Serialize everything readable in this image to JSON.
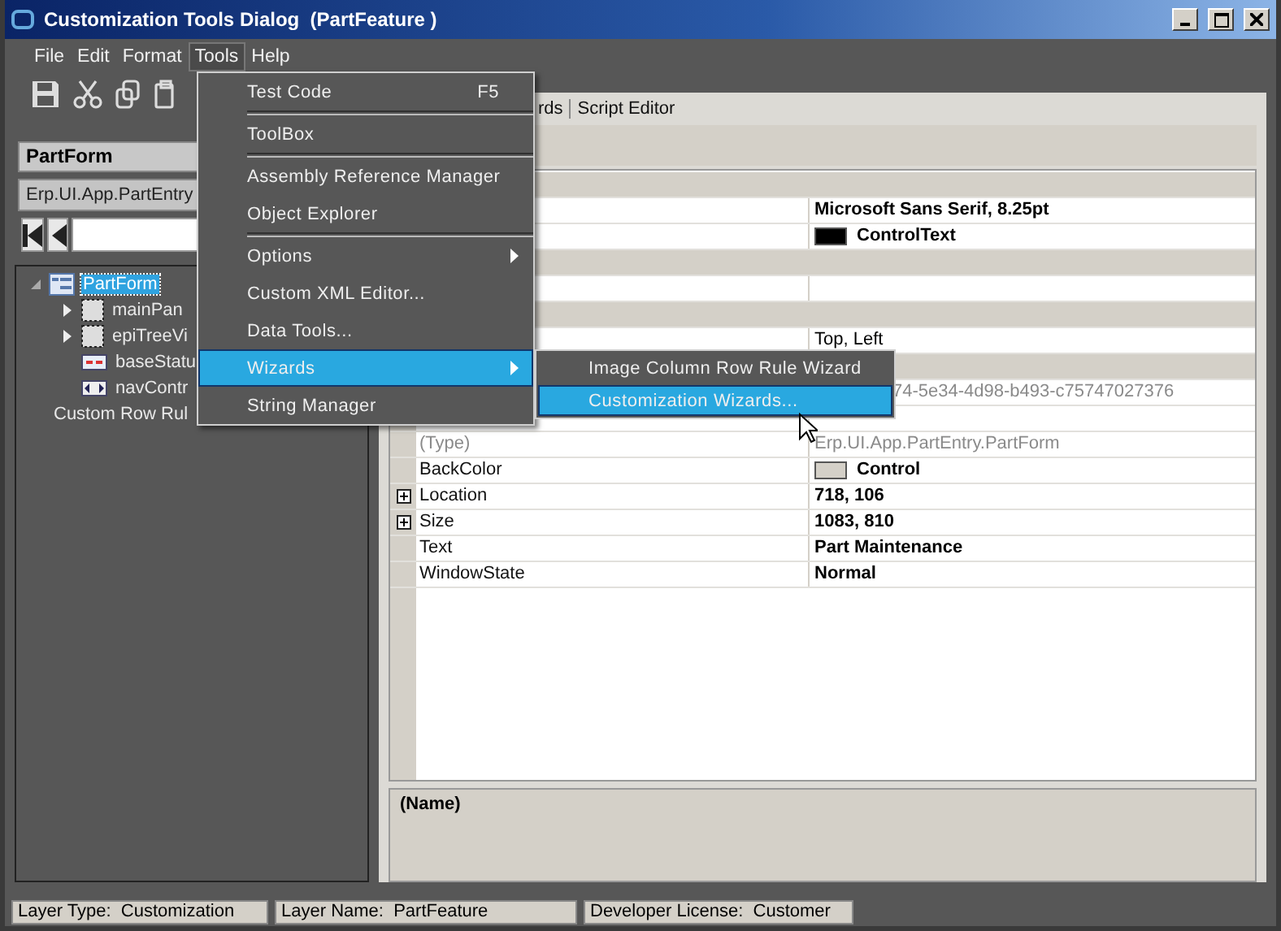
{
  "window": {
    "title": "Customization Tools Dialog  (PartFeature )"
  },
  "menu_bar": [
    {
      "label": "File",
      "selected": false
    },
    {
      "label": "Edit",
      "selected": false
    },
    {
      "label": "Format",
      "selected": false
    },
    {
      "label": "Tools",
      "selected": true
    },
    {
      "label": "Help",
      "selected": false
    }
  ],
  "tools_menu": [
    {
      "kind": "item",
      "label": "Test Code",
      "shortcut": "F5",
      "submenu": false,
      "selected": false
    },
    {
      "kind": "separator"
    },
    {
      "kind": "item",
      "label": "ToolBox",
      "submenu": false,
      "selected": false
    },
    {
      "kind": "separator"
    },
    {
      "kind": "item",
      "label": "Assembly Reference Manager",
      "submenu": false,
      "selected": false
    },
    {
      "kind": "item",
      "label": "Object Explorer",
      "submenu": false,
      "selected": false
    },
    {
      "kind": "separator"
    },
    {
      "kind": "item",
      "label": "Options",
      "submenu": true,
      "selected": false
    },
    {
      "kind": "item",
      "label": "Custom XML Editor...",
      "submenu": false,
      "selected": false
    },
    {
      "kind": "item",
      "label": "Data Tools...",
      "submenu": false,
      "selected": false
    },
    {
      "kind": "item",
      "label": "Wizards",
      "submenu": true,
      "selected": true
    },
    {
      "kind": "item",
      "label": "String Manager",
      "submenu": false,
      "selected": false
    }
  ],
  "wizards_submenu": [
    {
      "label": "Image Column Row Rule Wizard",
      "selected": false
    },
    {
      "label": "Customization Wizards...",
      "selected": true
    }
  ],
  "left_panel": {
    "form_name": "PartForm",
    "type_path": "Erp.UI.App.PartEntry",
    "tree": [
      {
        "label": "PartForm",
        "kind": "form",
        "selected": true,
        "expanded": true,
        "children": [
          {
            "label": "mainPan",
            "kind": "panel",
            "selected": false,
            "expanded": false
          },
          {
            "label": "epiTreeVi",
            "kind": "panel",
            "selected": false,
            "expanded": false
          },
          {
            "label": "baseStatu",
            "kind": "statusbar",
            "selected": false
          },
          {
            "label": "navContr",
            "kind": "navigator",
            "selected": false
          }
        ]
      },
      {
        "label": "Custom Row Rul",
        "kind": "text",
        "selected": false
      }
    ]
  },
  "tabs": [
    {
      "label": "rds"
    },
    {
      "label": "Script Editor"
    }
  ],
  "properties": [
    {
      "kind": "category"
    },
    {
      "kind": "property",
      "value": "Microsoft Sans Serif, 8.25pt",
      "bold": true,
      "readonly": false
    },
    {
      "kind": "property",
      "value": "ControlText",
      "bold": true,
      "readonly": false,
      "color": "#000000"
    },
    {
      "kind": "category"
    },
    {
      "kind": "property"
    },
    {
      "kind": "category"
    },
    {
      "kind": "property",
      "value": "Top, Left",
      "bold": false,
      "readonly": false
    },
    {
      "kind": "category"
    },
    {
      "kind": "property",
      "value": "74-5e34-4d98-b493-c75747027376",
      "bold": false,
      "readonly": true,
      "clipped": true
    },
    {
      "kind": "property"
    },
    {
      "kind": "property",
      "name": "(Type)",
      "value": "Erp.UI.App.PartEntry.PartForm",
      "bold": false,
      "readonly": true
    },
    {
      "kind": "property",
      "name": "BackColor",
      "value": "Control",
      "bold": true,
      "readonly": false,
      "color": "#d4d0c8"
    },
    {
      "kind": "property",
      "name": "Location",
      "value": "718, 106",
      "bold": true,
      "readonly": false,
      "expandable": true
    },
    {
      "kind": "property",
      "name": "Size",
      "value": "1083, 810",
      "bold": true,
      "readonly": false,
      "expandable": true
    },
    {
      "kind": "property",
      "name": "Text",
      "value": "Part Maintenance",
      "bold": true,
      "readonly": false
    },
    {
      "kind": "property",
      "name": "WindowState",
      "value": "Normal",
      "bold": true,
      "readonly": false
    }
  ],
  "description": {
    "title": "(Name)"
  },
  "status_bar": [
    "Layer Type:  Customization",
    "Layer Name:  PartFeature",
    "Developer License:  Customer"
  ]
}
